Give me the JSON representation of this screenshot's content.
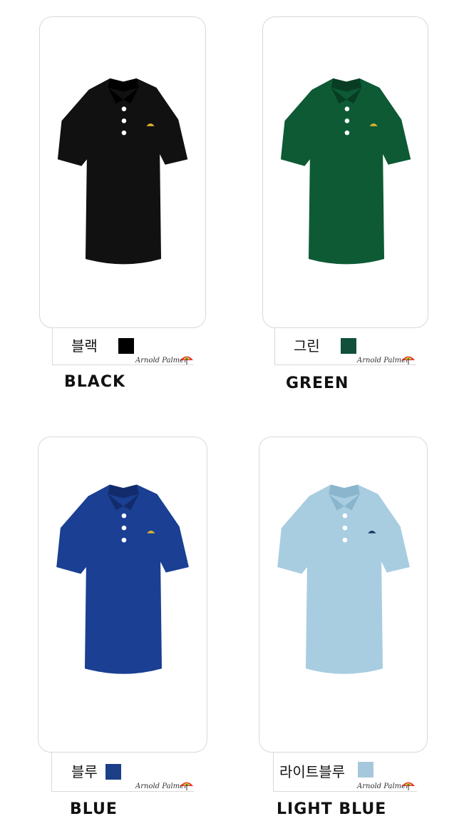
{
  "products": [
    {
      "ko_label": "블랙",
      "en_label": "BLACK",
      "color": "#111111",
      "shade": "#000000",
      "swatch": "#000000",
      "logo": "Arnold Palmer"
    },
    {
      "ko_label": "그린",
      "en_label": "GREEN",
      "color": "#0d5a35",
      "shade": "#083d24",
      "swatch": "#11503a",
      "logo": "Arnold Palmer"
    },
    {
      "ko_label": "블루",
      "en_label": "BLUE",
      "color": "#1a3f93",
      "shade": "#122c6b",
      "swatch": "#1c3f87",
      "logo": "Arnold Palmer"
    },
    {
      "ko_label": "라이트블루",
      "en_label": "LIGHT BLUE",
      "color": "#a8cde0",
      "shade": "#8ab5cc",
      "swatch": "#a7c8dc",
      "logo": "Arnold Palmer"
    }
  ]
}
